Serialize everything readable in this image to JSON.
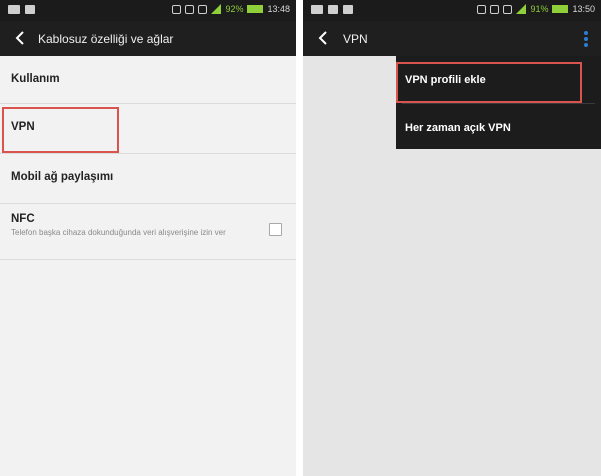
{
  "left_screen": {
    "status_bar": {
      "battery_percent": "92%",
      "time": "13:48"
    },
    "action_bar": {
      "title": "Kablosuz özelliği ve ağlar"
    },
    "items": [
      {
        "label": "Kullanım"
      },
      {
        "label": "VPN"
      },
      {
        "label": "Mobil ağ paylaşımı"
      },
      {
        "label": "NFC",
        "description": "Telefon başka cihaza dokunduğunda veri alışverişine izin ver",
        "checked": false
      }
    ]
  },
  "right_screen": {
    "status_bar": {
      "battery_percent": "91%",
      "time": "13:50"
    },
    "action_bar": {
      "title": "VPN"
    },
    "menu": {
      "items": [
        {
          "label": "VPN profili ekle"
        },
        {
          "label": "Her zaman açık VPN"
        }
      ]
    }
  },
  "colors": {
    "highlight": "#d9534f",
    "statusbar": "#1b1b1b",
    "actionbar": "#1f1f1f",
    "signal": "#8fcf3a",
    "overflow_dots": "#2a7fd4"
  }
}
